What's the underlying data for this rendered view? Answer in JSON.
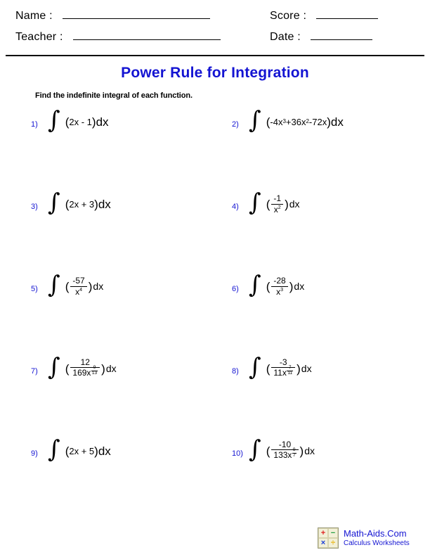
{
  "header": {
    "name_label": "Name :",
    "teacher_label": "Teacher :",
    "score_label": "Score :",
    "date_label": "Date :",
    "name_value": "",
    "teacher_value": "",
    "score_value": "",
    "date_value": ""
  },
  "title": "Power Rule for Integration",
  "instructions": "Find the indefinite integral of each function.",
  "integral_sign": "∫",
  "problems": [
    {
      "number": "1)",
      "kind": "inline",
      "text": "(2x - 1)dx",
      "parts": {
        "open": "(",
        "body": "2x - 1",
        "close": ")dx"
      }
    },
    {
      "number": "2)",
      "kind": "inline-sup",
      "open": "(",
      "coef1": "-4x",
      "exp1": "3",
      "op1": " + ",
      "coef2": "36x",
      "exp2": "2",
      "op2": " - ",
      "coef3": "72x",
      "close": ")dx"
    },
    {
      "number": "3)",
      "kind": "inline",
      "text": "(2x + 3)dx",
      "parts": {
        "open": "(",
        "body": "2x + 3",
        "close": ")dx"
      }
    },
    {
      "number": "4)",
      "kind": "fraction",
      "numerator": "-1",
      "den_base": "x",
      "den_exp": "2",
      "den_exp_frac": null,
      "open": "(",
      "close": ")dx"
    },
    {
      "number": "5)",
      "kind": "fraction",
      "numerator": "-57",
      "den_base": "x",
      "den_exp": "4",
      "den_exp_frac": null,
      "open": "(",
      "close": ")dx"
    },
    {
      "number": "6)",
      "kind": "fraction",
      "numerator": "-28",
      "den_base": "x",
      "den_exp": "3",
      "den_exp_frac": null,
      "open": "(",
      "close": ")dx"
    },
    {
      "number": "7)",
      "kind": "fraction",
      "numerator": "12",
      "den_base": "169x",
      "den_exp": null,
      "den_exp_frac": {
        "num": "9",
        "den": "13"
      },
      "open": "(",
      "close": ")dx"
    },
    {
      "number": "8)",
      "kind": "fraction",
      "numerator": "-3",
      "den_base": "11x",
      "den_exp": null,
      "den_exp_frac": {
        "num": "7",
        "den": "11"
      },
      "open": "(",
      "close": ")dx"
    },
    {
      "number": "9)",
      "kind": "inline",
      "text": "(2x + 5)dx",
      "parts": {
        "open": "(",
        "body": "2x + 5",
        "close": ")dx"
      }
    },
    {
      "number": "10)",
      "kind": "fraction",
      "numerator": "-10",
      "den_base": "133x",
      "den_exp": null,
      "den_exp_frac": {
        "num": "9",
        "den": "7"
      },
      "open": "(",
      "close": ")dx"
    }
  ],
  "footer": {
    "logo_cells": [
      "+",
      "−",
      "×",
      "÷"
    ],
    "brand": "Math-Aids.Com",
    "subtitle": "Calculus Worksheets"
  },
  "colors": {
    "accent_blue": "#1414d2",
    "text_black": "#000000",
    "logo_plus": "#e02020",
    "logo_minus": "#1f9e3f",
    "logo_times": "#1a3fd8",
    "logo_divide": "#e8b000"
  }
}
